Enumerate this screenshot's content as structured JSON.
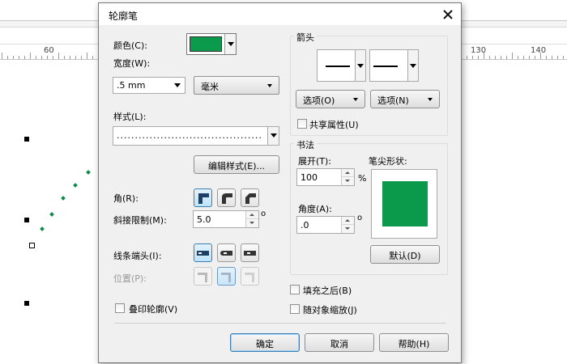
{
  "ruler": {
    "labels": [
      "60",
      "130",
      "140"
    ]
  },
  "dialog": {
    "title": "轮廓笔",
    "close_icon": "close-icon",
    "color": {
      "label": "颜色(C):",
      "swatch": "#0b9a4c"
    },
    "width": {
      "label": "宽度(W):",
      "value": ".5 mm",
      "unit": "毫米"
    },
    "style": {
      "label": "样式(L):",
      "value": "........................................"
    },
    "edit_style_button": "编辑样式(E)...",
    "corner": {
      "label": "角(R):"
    },
    "miter": {
      "label": "斜接限制(M):",
      "value": "5.0",
      "unit": "o"
    },
    "line_caps": {
      "label": "线条端头(I):"
    },
    "position": {
      "label": "位置(P):"
    },
    "overprint": {
      "label": "叠印轮廓(V)"
    },
    "arrows": {
      "group_label": "箭头",
      "options_left": "选项(O)",
      "options_right": "选项(N)",
      "share": "共享属性(U)"
    },
    "calligraphy": {
      "group_label": "书法",
      "stretch_label": "展开(T):",
      "stretch_value": "100",
      "stretch_unit": "%",
      "angle_label": "角度(A):",
      "angle_value": ".0",
      "angle_unit": "o",
      "nib_label": "笔尖形状:",
      "nib_color": "#0b9a4c",
      "default_button": "默认(D)"
    },
    "fill_behind": "填充之后(B)",
    "scale_with_image": "随对象缩放(J)",
    "buttons": {
      "ok": "确定",
      "cancel": "取消",
      "help": "帮助(H)"
    }
  }
}
